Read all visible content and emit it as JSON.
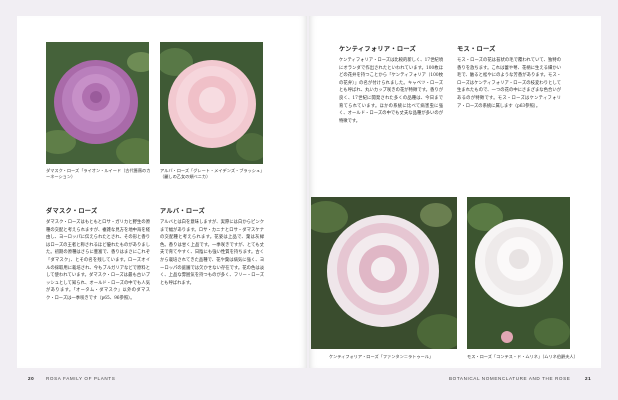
{
  "left_page": {
    "caption_1": "ダマスク・ローズ「ライオン・ルイード（古代薔薇のカーネーション）",
    "caption_2": "アルバ・ローズ「グレート・メイデンズ・ブラッシュ」（麗しの乙女の頬ベニカ）",
    "section_1": {
      "heading": "ダマスク・ローズ",
      "text": "ダマスク・ローズはもともとロサ・ガリカと野生の原種の交配と考えられますが、複雑な見方を地中海を経由し、ヨーロッパに伝えられたとされ、その形と香りはローズの王者と称されるほど優れたものがありました。初期の原種はさらに豊富で、香りはまさにこれぞ「ダマスク」、とその名を残しています。ローズオイルの採取用に栽培され、今もブルガリアなどで原料として使われています。ダマスク・ローズは最も古いブッシュとして知られ、オールド・ローズの中でも人気があります。「オータム・ダマスク」以外のダマスク・ローズは一季咲きです（p65、96参照）。"
    },
    "section_2": {
      "heading": "アルバ・ローズ",
      "text": "アルバとは白を意味しますが、実際には白からピンクまで幅があります。ロサ・カニナとロサ・ダマスケナの交配種と考えられます。花姿は上品で、葉は灰緑色。香りは甘く上品です。一季咲きですが、とても丈夫で育てやすく、日陰にも強い性質を持ちます。古くから栽培されてきた品種で、花や葉は病気に強く、ヨーロッパの庭園では欠かせない存在です。花の色は淡く、上品な雰囲気を持つものが多く、フリー・ローズとも呼ばれます。"
    }
  },
  "right_page": {
    "section_1": {
      "heading": "ケンティフォリア・ローズ",
      "text": "ケンティフォリア・ローズは比較的新しく、17世紀頃にオランダで作出されたといわれています。100枚ほどの花弁を持つことから「ケンティフォリア（100枚の花弁）」の名が付けられました。キャベツ・ローズとも呼ばれ、丸いカップ咲きの花が特徴です。香りが良く、17世紀に開発された多くの品種は、今日まで育てられています。ほかの系統に比べて病害虫に強く、オールド・ローズの中でも丈夫な品種が多いのが特徴です。"
    },
    "section_2": {
      "heading": "モス・ローズ",
      "text": "モス・ローズの花は苔状の毛で覆われていて、独特の香りを放ちます。これは蕾や萼、花柄に生える細かい毛で、触ると松やにのような芳香があります。モス・ローズはケンティフォリア・ローズの枝変わりとして生まれたもので、一つの花の中にさまざまな色合いがあるのが特徴です。モス・ローズはケンティフォリア・ローズの系統に属します（p63参照）。"
    },
    "caption_3": "ケンティフォリア・ローズ「ファンタン＝ラトゥール」",
    "caption_4": "モス・ローズ「コンテス・ド・ムリネ」（ムリネ伯爵夫人）"
  },
  "footer": {
    "left_folio": "20",
    "left_title": "ROSA FAMILY OF PLANTS",
    "right_title": "BOTANICAL NOMENCLATURE AND THE ROSE",
    "right_folio": "21"
  },
  "colors": {
    "background": "#f1eef3",
    "page": "#ffffff",
    "rose_purple": "#b478b4",
    "rose_pink": "#f0c4cc",
    "rose_white": "#f6f2f2",
    "leaf_green": "#4e6a3e"
  }
}
